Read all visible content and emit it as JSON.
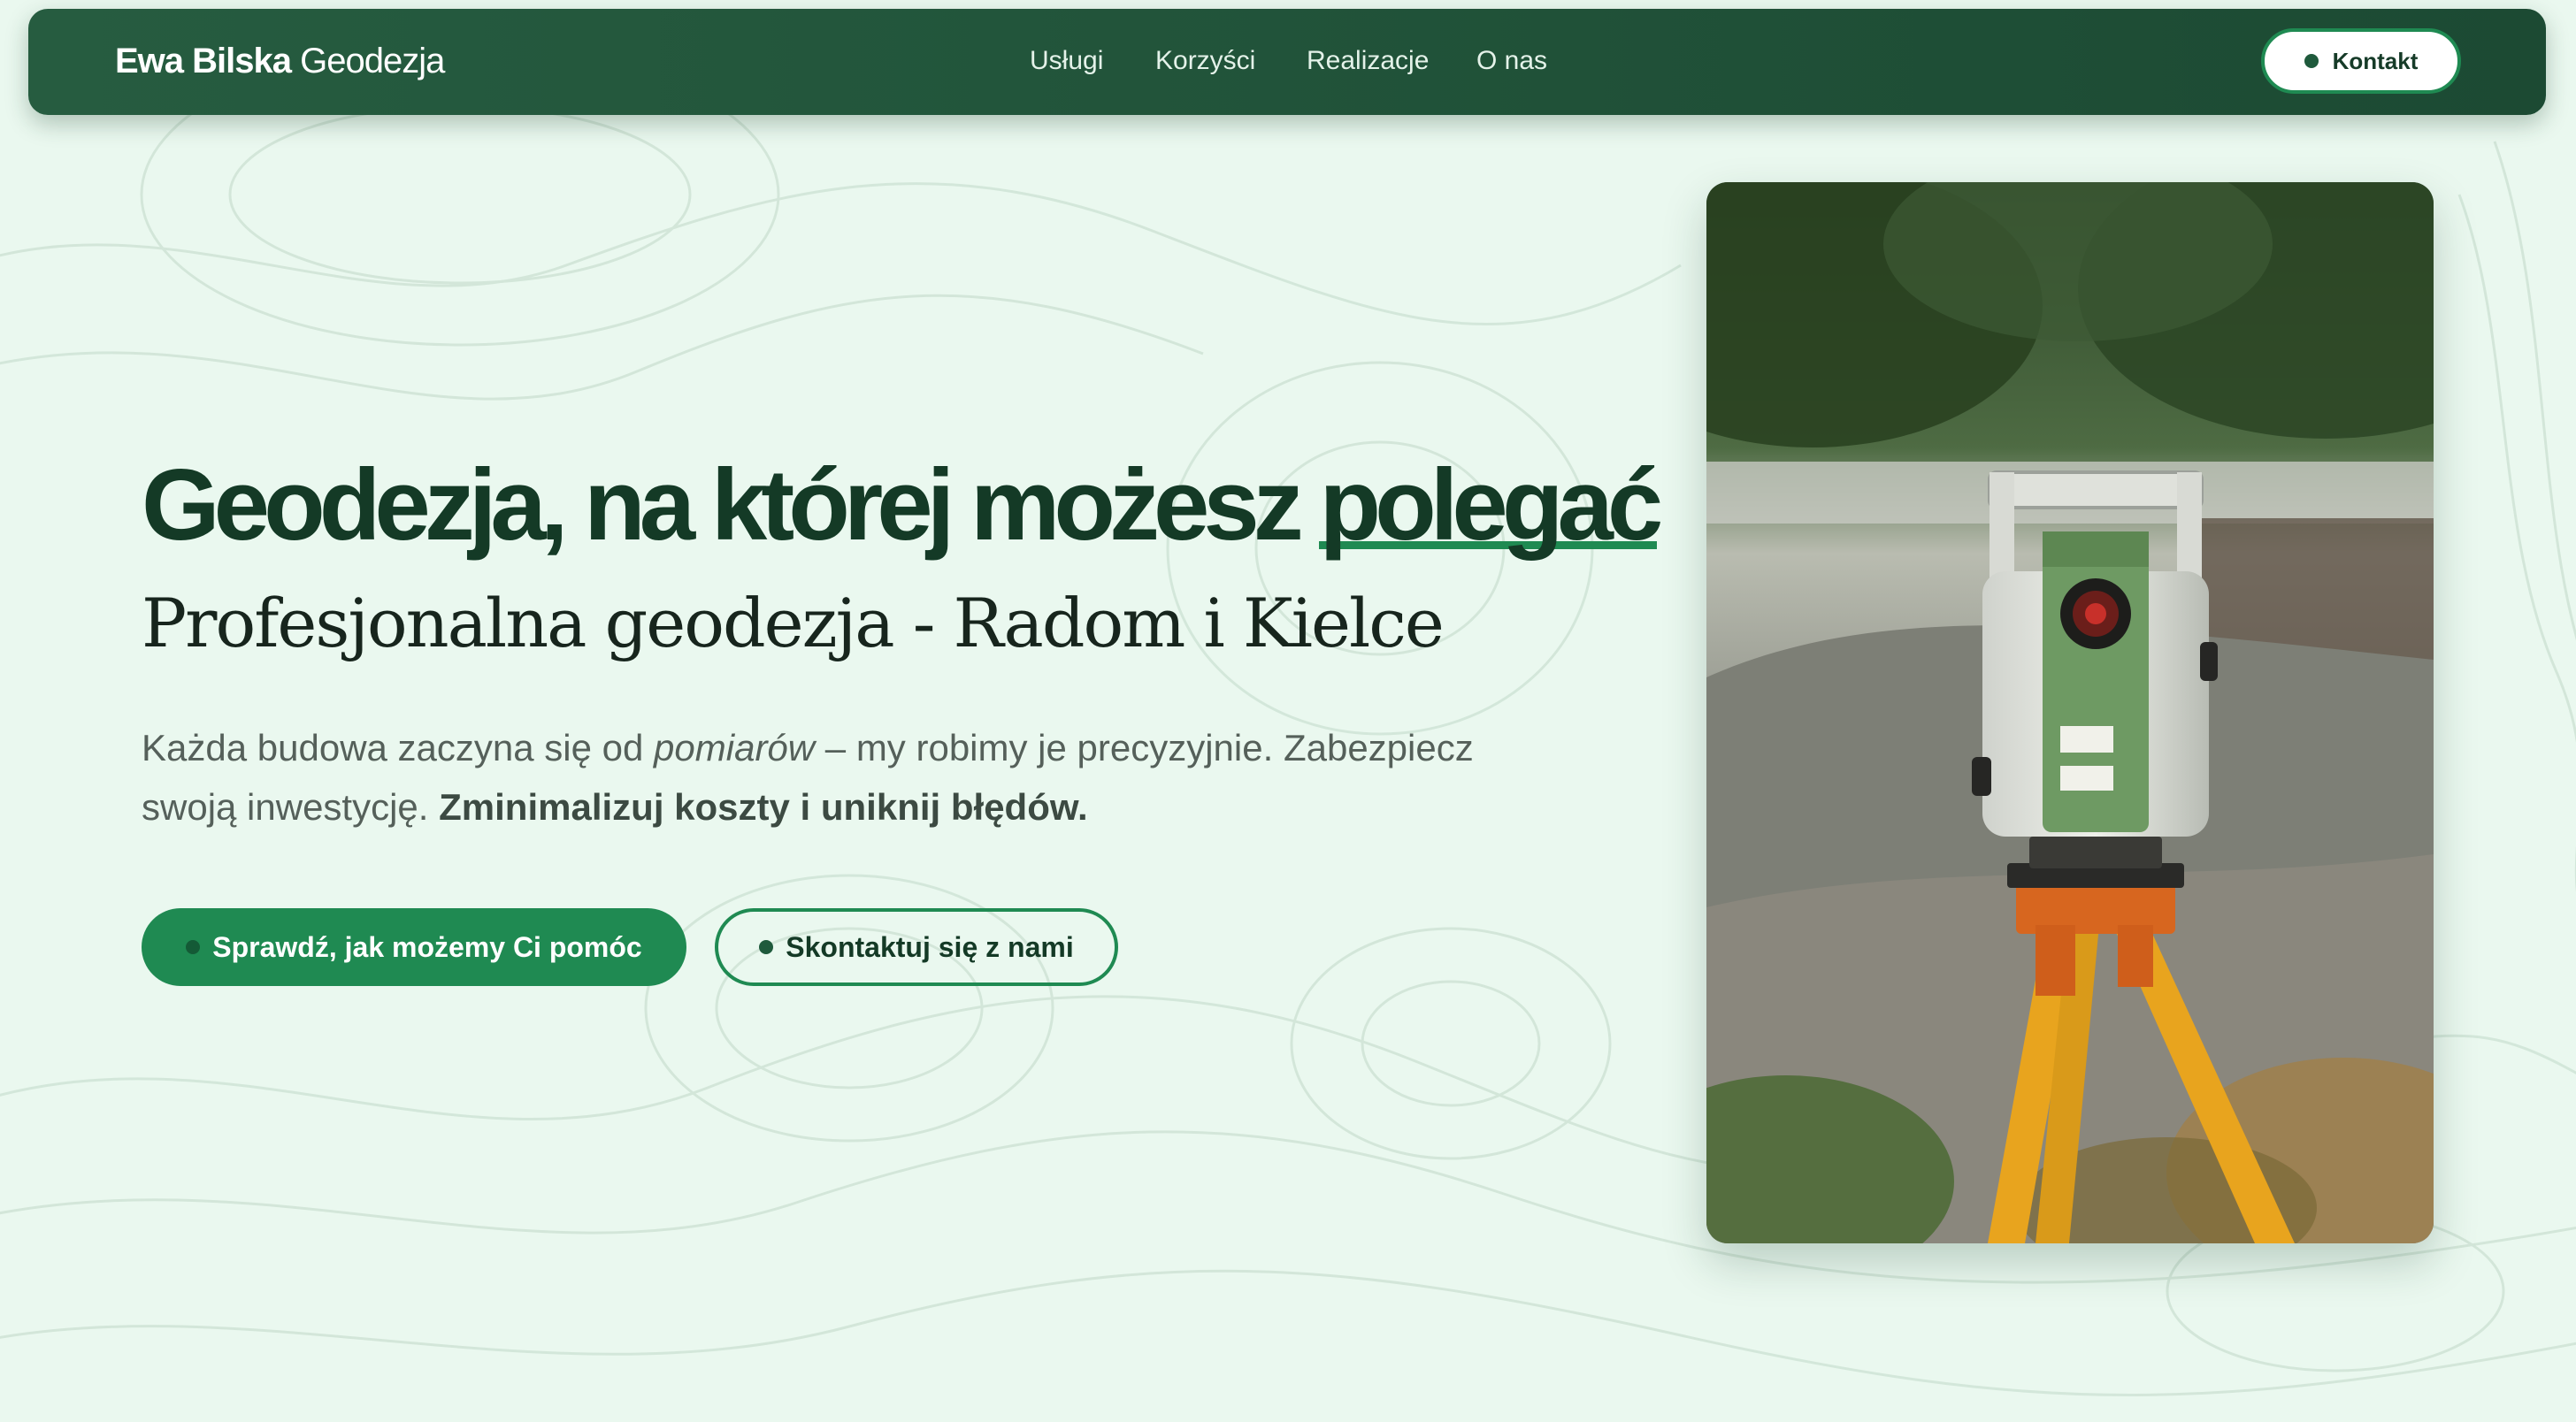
{
  "nav": {
    "brand_bold": "Ewa Bilska",
    "brand_rest": " Geodezja",
    "links": [
      "Usługi",
      "Korzyści",
      "Realizacje",
      "O nas"
    ],
    "contact_label": "Kontakt"
  },
  "hero": {
    "headline_main": "Geodezja, na której możesz ",
    "headline_accent": "polegać",
    "subtitle": "Profesjonalna geodezja - Radom i Kielce",
    "lead_part1": "Każda budowa zaczyna się od ",
    "lead_em": "pomiarów",
    "lead_part2": " – my robimy je precyzyjnie. Zabezpiecz swoją inwestycję. ",
    "lead_strong": "Zminimalizuj koszty i uniknij błędów.",
    "primary_cta": "Sprawdź, jak możemy Ci pomóc",
    "secondary_cta": "Skontaktuj się z nami"
  },
  "colors": {
    "nav_background": "#1f4e36",
    "accent": "#1f8a52",
    "page_background": "#eaf8ef"
  }
}
